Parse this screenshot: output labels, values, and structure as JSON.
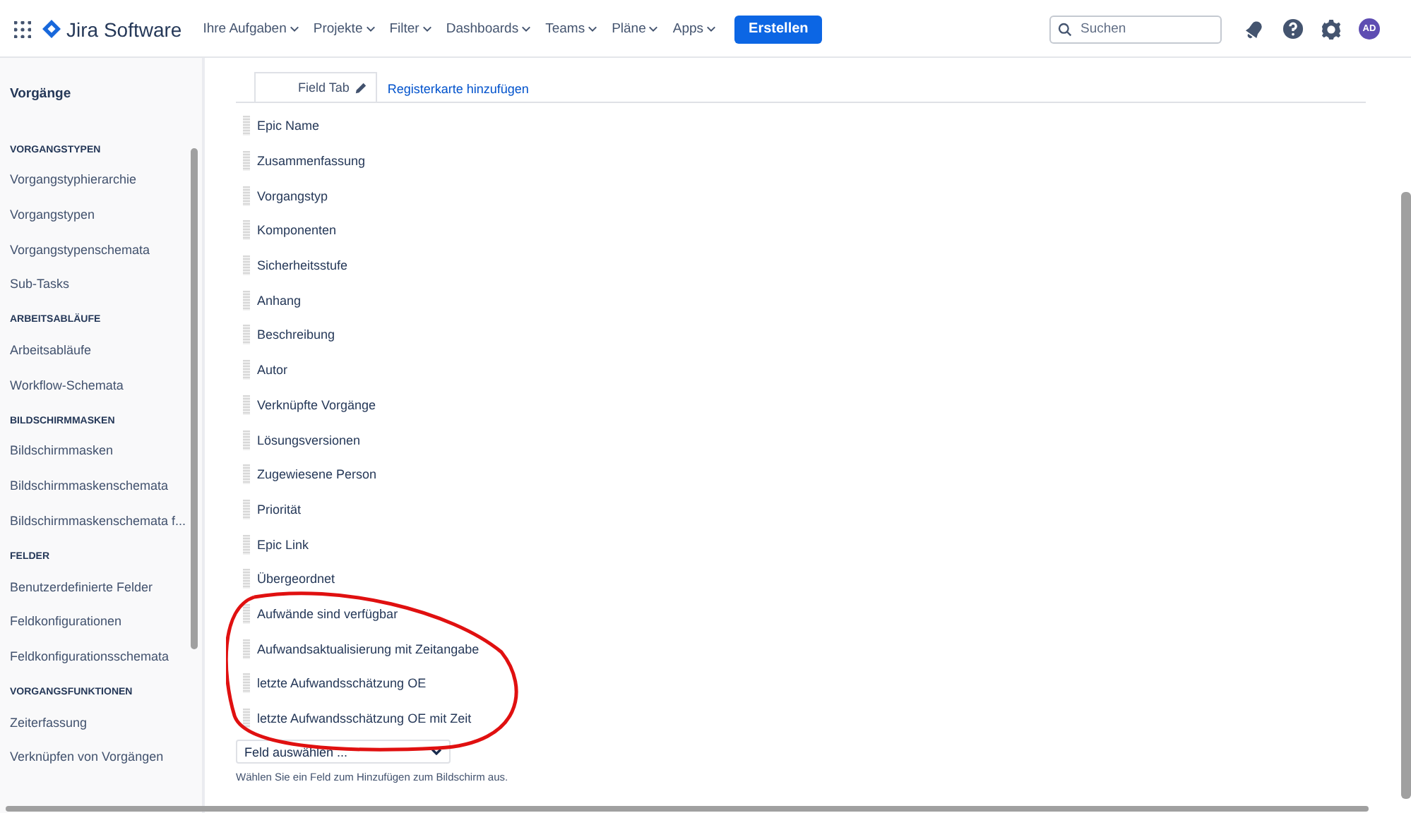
{
  "topbar": {
    "product": "Jira Software",
    "menus": [
      {
        "label": "Ihre Aufgaben"
      },
      {
        "label": "Projekte"
      },
      {
        "label": "Filter"
      },
      {
        "label": "Dashboards"
      },
      {
        "label": "Teams"
      },
      {
        "label": "Pläne"
      },
      {
        "label": "Apps"
      }
    ],
    "create_button": "Erstellen",
    "search": {
      "placeholder": "Suchen"
    },
    "avatar": "AD"
  },
  "sidebar": {
    "title": "Vorgänge",
    "sections": [
      {
        "heading": "VORGANGSTYPEN",
        "items": [
          "Vorgangstyphierarchie",
          "Vorgangstypen",
          "Vorgangstypenschemata",
          "Sub-Tasks"
        ]
      },
      {
        "heading": "ARBEITSABLÄUFE",
        "items": [
          "Arbeitsabläufe",
          "Workflow-Schemata"
        ]
      },
      {
        "heading": "BILDSCHIRMMASKEN",
        "items": [
          "Bildschirmmasken",
          "Bildschirmmaskenschemata",
          "Bildschirmmaskenschemata f..."
        ]
      },
      {
        "heading": "FELDER",
        "items": [
          "Benutzerdefinierte Felder",
          "Feldkonfigurationen",
          "Feldkonfigurationsschemata"
        ]
      },
      {
        "heading": "VORGANGSFUNKTIONEN",
        "items": [
          "Zeiterfassung",
          "Verknüpfen von Vorgängen"
        ]
      }
    ]
  },
  "tabs": [
    {
      "label": "Field Tab",
      "selected": true
    }
  ],
  "add_tab_link": "Registerkarte hinzufügen",
  "fields": [
    "Epic Name",
    "Zusammenfassung",
    "Vorgangstyp",
    "Komponenten",
    "Sicherheitsstufe",
    "Anhang",
    "Beschreibung",
    "Autor",
    "Verknüpfte Vorgänge",
    "Lösungsversionen",
    "Zugewiesene Person",
    "Priorität",
    "Epic Link",
    "Übergeordnet",
    "Aufwände sind verfügbar",
    "Aufwandsaktualisierung mit Zeitangabe",
    "letzte Aufwandsschätzung OE",
    "letzte Aufwandsschätzung OE mit Zeit"
  ],
  "field_select": {
    "value": "Feld auswählen ..."
  },
  "help_text": "Wählen Sie ein Feld zum Hinzufügen zum Bildschirm aus."
}
